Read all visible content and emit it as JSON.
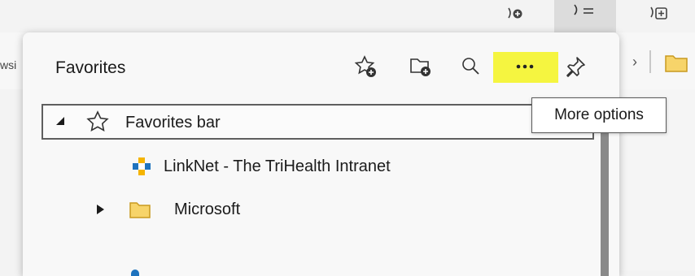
{
  "background": {
    "partial_text": "wsi",
    "chevron": "›"
  },
  "panel": {
    "title": "Favorites",
    "buttons": [
      "add-favorite-icon",
      "add-folder-icon",
      "search-icon",
      "more-options-icon",
      "pin-icon"
    ],
    "highlight_color": "#f5f540"
  },
  "favorites": {
    "bar_label": "Favorites bar",
    "item_1": "LinkNet - The TriHealth Intranet",
    "folder_1": "Microsoft"
  },
  "tooltip": {
    "text": "More options"
  }
}
